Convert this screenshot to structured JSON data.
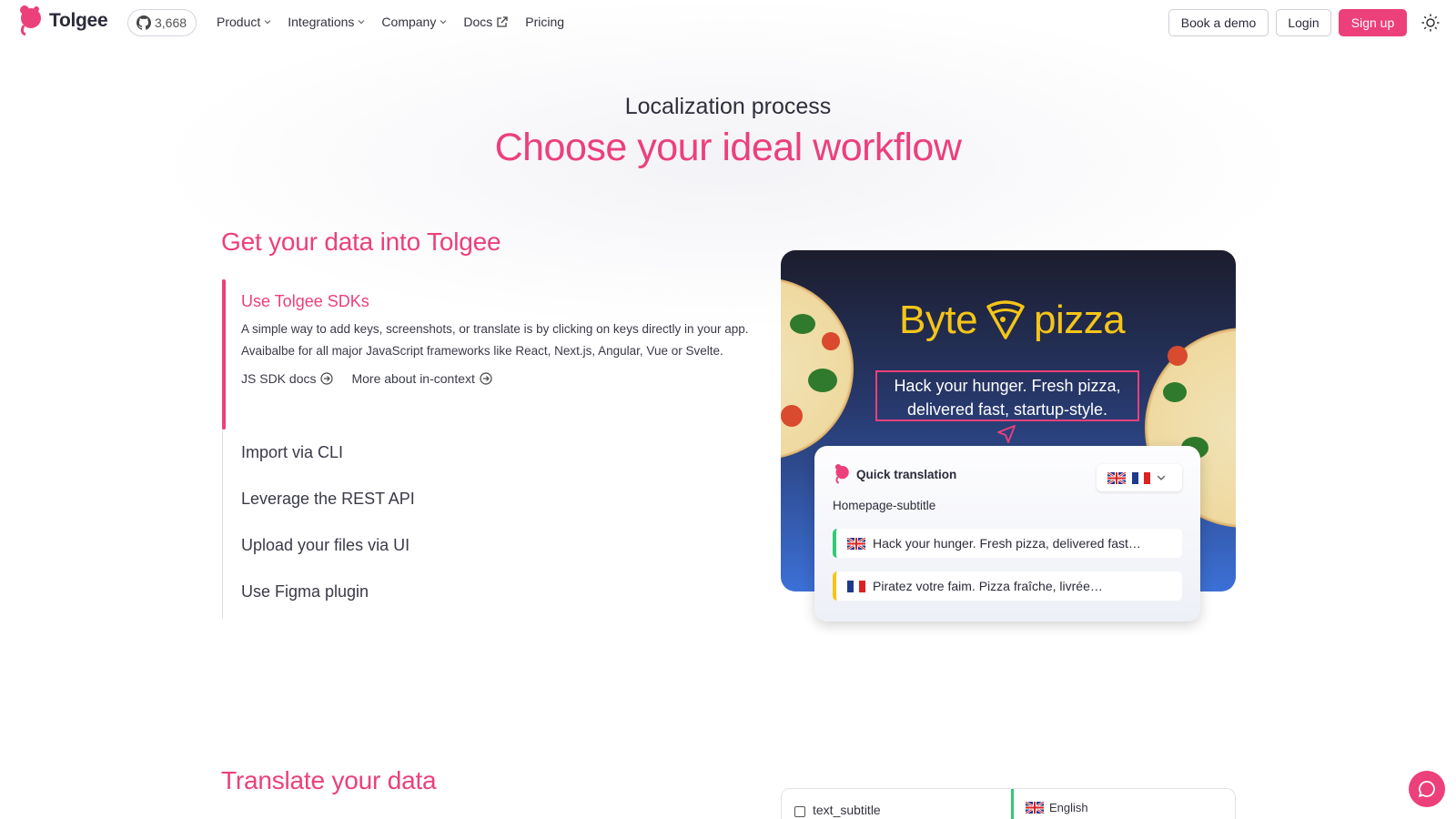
{
  "nav": {
    "brand": "Tolgee",
    "github_stars": "3,668",
    "menu": [
      {
        "label": "Product",
        "has_dropdown": true
      },
      {
        "label": "Integrations",
        "has_dropdown": true
      },
      {
        "label": "Company",
        "has_dropdown": true
      },
      {
        "label": "Docs",
        "external": true
      },
      {
        "label": "Pricing"
      }
    ],
    "book_demo": "Book a demo",
    "login": "Login",
    "signup": "Sign up",
    "theme_icon": "sun-icon"
  },
  "hero": {
    "subtitle": "Localization process",
    "title": "Choose your ideal workflow"
  },
  "section1": {
    "title": "Get your data into Tolgee",
    "active_step": {
      "title": "Use Tolgee SDKs",
      "description": "A simple way to add keys, screenshots, or translate is by clicking on keys directly in your app. Avaibalbe for all major JavaScript frameworks like React, Next.js, Angular, Vue or Svelte.",
      "links": [
        "JS SDK docs",
        "More about in-context"
      ]
    },
    "steps": [
      "Import via CLI",
      "Leverage the REST API",
      "Upload your files via UI",
      "Use Figma plugin"
    ]
  },
  "demo": {
    "brand_left": "Byte",
    "brand_right": "pizza",
    "tagline": "Hack your hunger. Fresh pizza, delivered fast, startup-style.",
    "quick_translation": {
      "title": "Quick translation",
      "key": "Homepage-subtitle",
      "rows": [
        {
          "lang": "en",
          "text": "Hack your hunger. Fresh pizza, delivered fast…"
        },
        {
          "lang": "fr",
          "text": "Piratez votre faim. Pizza fraîche, livrée…"
        }
      ]
    }
  },
  "section2": {
    "title": "Translate your data",
    "preview": {
      "key": "text_subtitle",
      "language": "English"
    }
  },
  "colors": {
    "accent": "#ec407a",
    "brand_yellow": "#f5c518",
    "success": "#2ecc71"
  }
}
